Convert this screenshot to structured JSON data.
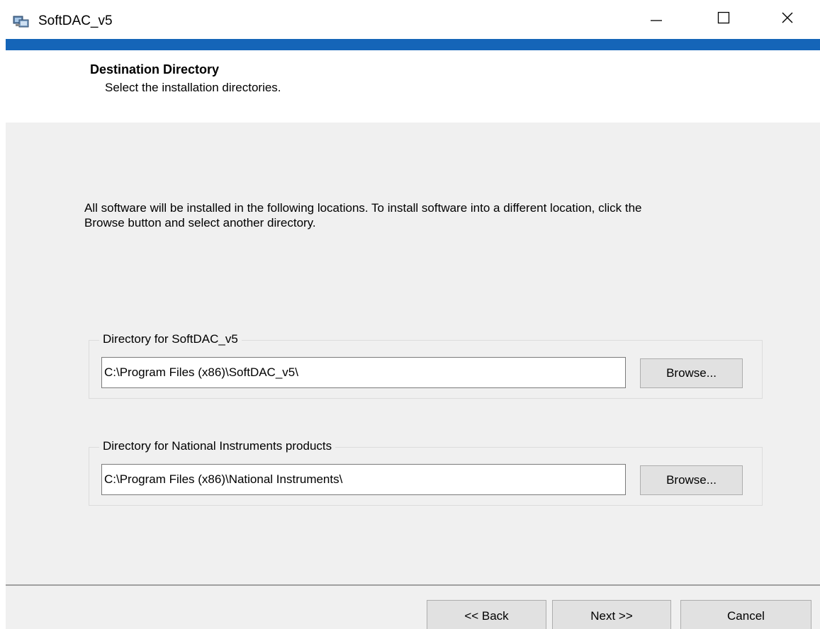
{
  "window": {
    "title": "SoftDAC_v5",
    "icon": "installer-icon",
    "controls": [
      "minimize-icon",
      "maximize-icon",
      "close-icon"
    ],
    "accent_color": "#1565b8"
  },
  "header": {
    "title": "Destination Directory",
    "subtitle": "Select the installation directories."
  },
  "body": {
    "intro": "All software will be installed in the following locations. To install software into a different location, click the Browse button and select another directory.",
    "groups": [
      {
        "label": "Directory for SoftDAC_v5",
        "path": "C:\\Program Files (x86)\\SoftDAC_v5\\",
        "browse_label": "Browse..."
      },
      {
        "label": "Directory for National Instruments products",
        "path": "C:\\Program Files (x86)\\National Instruments\\",
        "browse_label": "Browse..."
      }
    ]
  },
  "footer": {
    "back_label": "<< Back",
    "next_label": "Next >>",
    "cancel_label": "Cancel"
  }
}
